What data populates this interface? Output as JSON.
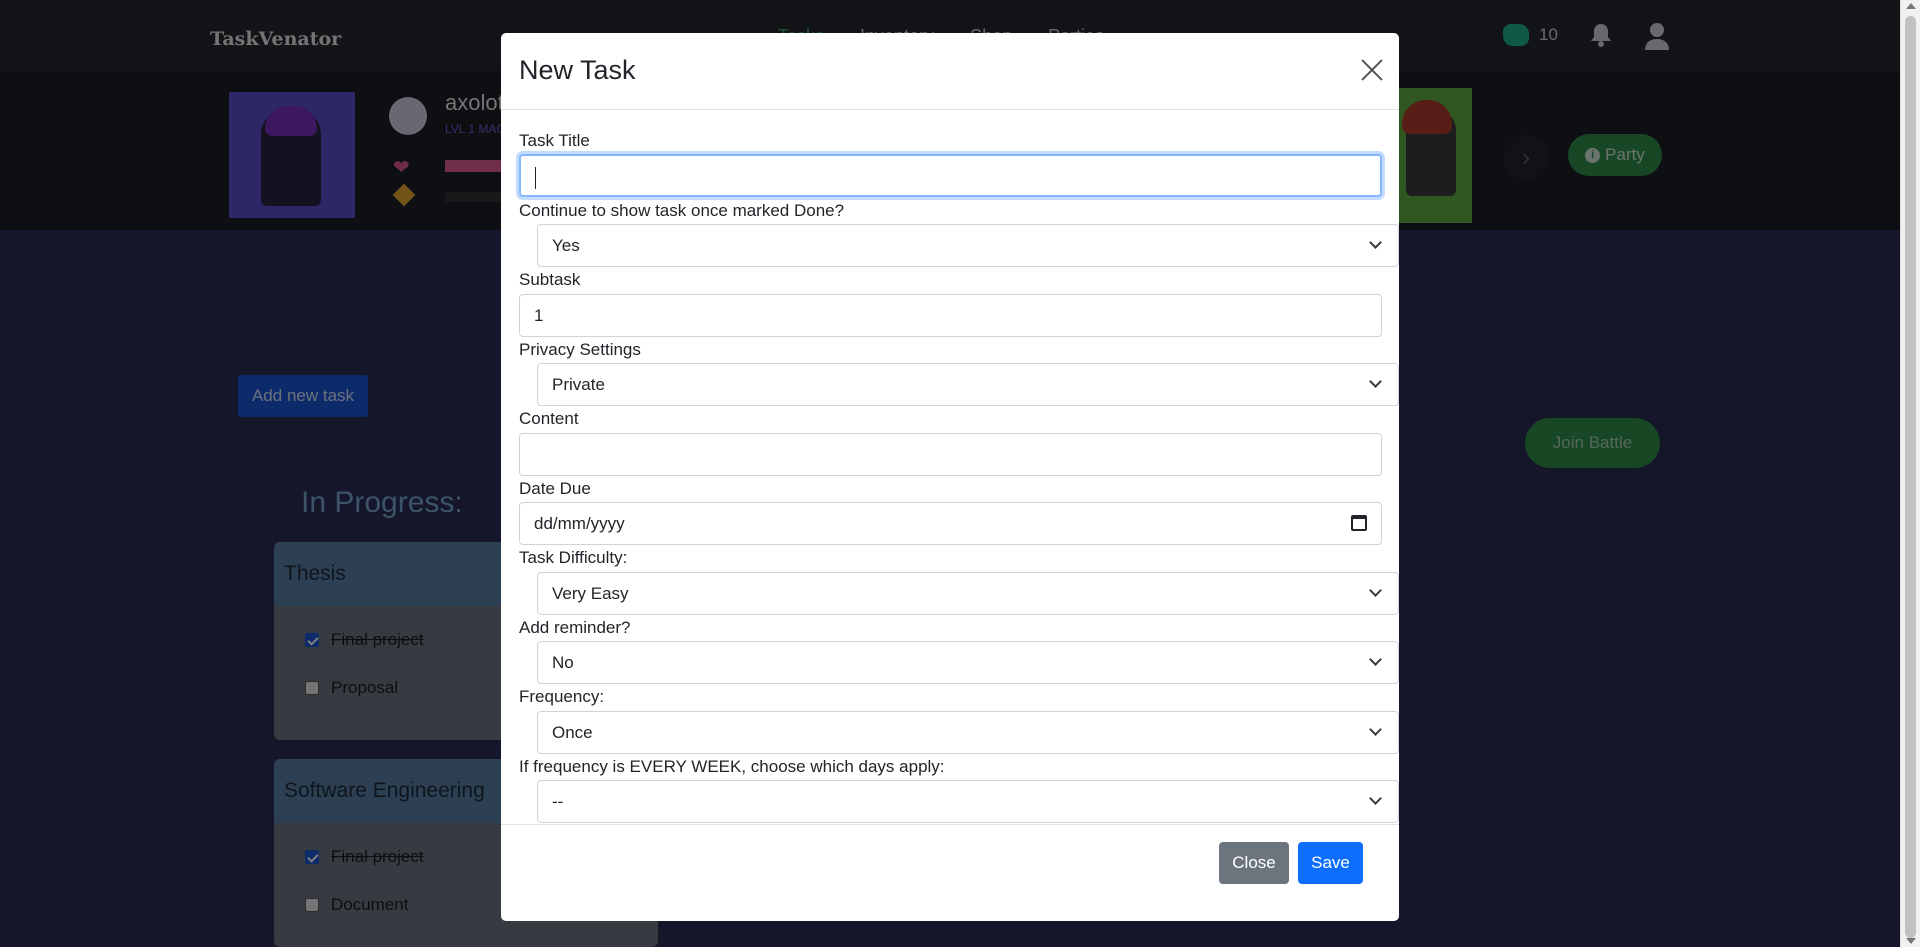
{
  "app": {
    "brand": "TaskVenator",
    "nav": [
      "Tasks",
      "Inventory",
      "Shop",
      "Parties"
    ],
    "gem_count": "10"
  },
  "profile": {
    "username": "axolot",
    "level": "LVL 1 MAG"
  },
  "party_button": "Party",
  "add_task_button": "Add new task",
  "join_battle_button": "Join Battle",
  "in_progress_heading": "In Progress:",
  "cards": [
    {
      "title": "Thesis",
      "items": [
        {
          "label": "Final project",
          "done": true
        },
        {
          "label": "Proposal",
          "done": false
        }
      ]
    },
    {
      "title": "Software Engineering",
      "items": [
        {
          "label": "Final project",
          "done": true
        },
        {
          "label": "Document",
          "done": false
        }
      ]
    }
  ],
  "modal": {
    "title": "New Task",
    "fields": {
      "task_title": {
        "label": "Task Title",
        "value": ""
      },
      "continue_show": {
        "label": "Continue to show task once marked Done?",
        "value": "Yes"
      },
      "subtask": {
        "label": "Subtask",
        "value": "1"
      },
      "privacy": {
        "label": "Privacy Settings",
        "value": "Private"
      },
      "content": {
        "label": "Content",
        "value": ""
      },
      "date_due": {
        "label": "Date Due",
        "value": "dd/mm/yyyy"
      },
      "difficulty": {
        "label": "Task Difficulty:",
        "value": "Very Easy"
      },
      "reminder": {
        "label": "Add reminder?",
        "value": "No"
      },
      "frequency": {
        "label": "Frequency:",
        "value": "Once"
      },
      "weekdays": {
        "label": "If frequency is EVERY WEEK, choose which days apply:",
        "value": "--"
      }
    },
    "close_button": "Close",
    "save_button": "Save"
  }
}
